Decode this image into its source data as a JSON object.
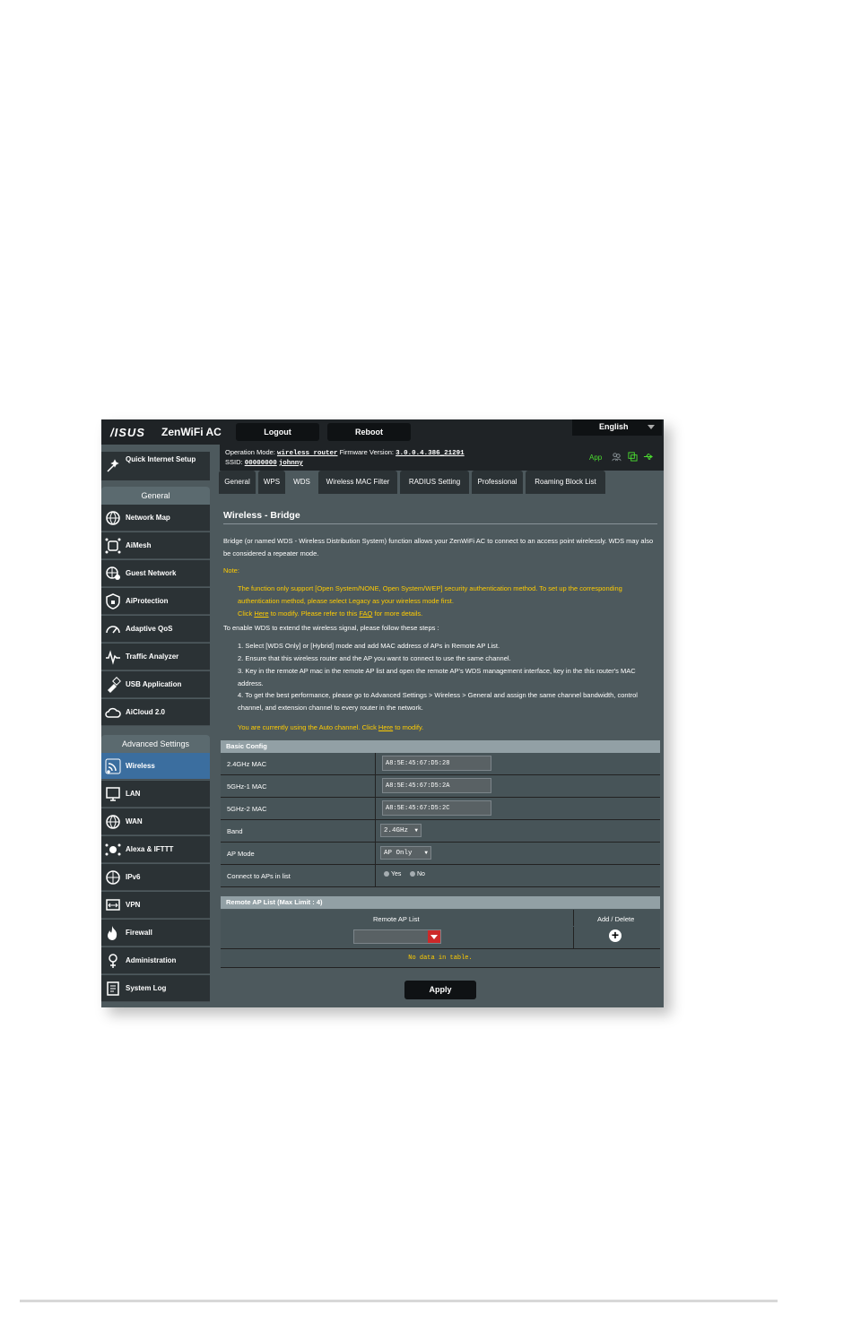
{
  "header": {
    "brand": "/ISUS",
    "model": "ZenWiFi AC",
    "logout": "Logout",
    "reboot": "Reboot",
    "language": "English"
  },
  "info": {
    "op_mode_label": "Operation Mode:",
    "op_mode_value": "wireless router",
    "fw_label": "Firmware Version:",
    "fw_value": "3.0.0.4.386_21291",
    "ssid_label": "SSID:",
    "ssid_1": "00000000",
    "ssid_2": "johnny",
    "app": "App"
  },
  "sidebar": {
    "quick_setup": "Quick Internet Setup",
    "general_header": "General",
    "general_items": [
      "Network Map",
      "AiMesh",
      "Guest Network",
      "AiProtection",
      "Adaptive QoS",
      "Traffic Analyzer",
      "USB Application",
      "AiCloud 2.0"
    ],
    "advanced_header": "Advanced Settings",
    "advanced_items": [
      "Wireless",
      "LAN",
      "WAN",
      "Alexa & IFTTT",
      "IPv6",
      "VPN",
      "Firewall",
      "Administration",
      "System Log"
    ]
  },
  "tabs": [
    "General",
    "WPS",
    "WDS",
    "Wireless MAC Filter",
    "RADIUS Setting",
    "Professional",
    "Roaming Block List"
  ],
  "page": {
    "title": "Wireless - Bridge",
    "desc": "Bridge (or named WDS - Wireless Distribution System) function allows your ZenWiFi AC to connect to an access point wirelessly. WDS may also be considered a repeater mode.",
    "note_label": "Note:",
    "note_1": "The function only support [Open System/NONE, Open System/WEP] security authentication method. To set up the corresponding authentication method, please select Legacy as your wireless mode first.",
    "note_2a": "Click",
    "note_2_here": "Here",
    "note_2b": "to modify. Please refer to this",
    "note_2_faq": "FAQ",
    "note_2c": "for more details.",
    "steps_intro": "To enable WDS to extend the wireless signal, please follow these steps :",
    "step_1": "1. Select [WDS Only] or [Hybrid] mode and add MAC address of APs in Remote AP List.",
    "step_2": "2. Ensure that this wireless router and the AP you want to connect to use the same channel.",
    "step_3": "3. Key in the remote AP mac in the remote AP list and open the remote AP's WDS management interface, key in the this router's MAC address.",
    "step_4": "4. To get the best performance, please go to Advanced Settings > Wireless > General and assign the same channel bandwidth, control channel, and extension channel to every router in the network.",
    "auto_a": "You are currently using the Auto channel. Click",
    "auto_here": "Here",
    "auto_b": "to modify."
  },
  "basic_config": {
    "header": "Basic Config",
    "mac24_label": "2.4GHz MAC",
    "mac24_value": "A8:5E:45:67:D5:28",
    "mac5a_label": "5GHz-1 MAC",
    "mac5a_value": "A8:5E:45:67:D5:2A",
    "mac5b_label": "5GHz-2 MAC",
    "mac5b_value": "A8:5E:45:67:D5:2C",
    "band_label": "Band",
    "band_value": "2.4GHz",
    "apmode_label": "AP Mode",
    "apmode_value": "AP Only",
    "connect_label": "Connect to APs in list",
    "yes": "Yes",
    "no": "No"
  },
  "remote_ap": {
    "header": "Remote AP List (Max Limit : 4)",
    "col_list": "Remote AP List",
    "col_action": "Add / Delete",
    "nodata": "No data in table.",
    "apply": "Apply"
  }
}
